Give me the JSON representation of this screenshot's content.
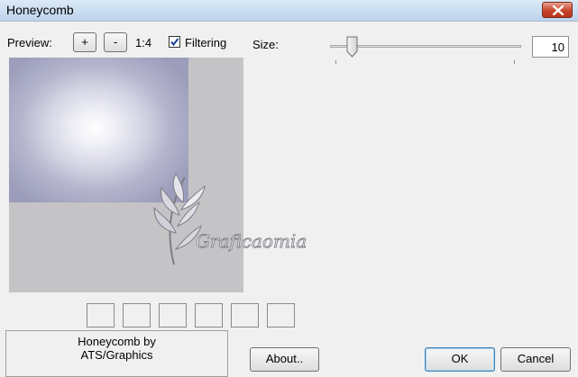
{
  "window": {
    "title": "Honeycomb"
  },
  "toolbar": {
    "preview_label": "Preview:",
    "zoom_in_label": "+",
    "zoom_out_label": "-",
    "zoom_level": "1:4",
    "filtering_label": "Filtering",
    "filtering_checked": true
  },
  "size": {
    "label": "Size:",
    "value": "10"
  },
  "watermark": {
    "text": "Graficaomia"
  },
  "info": {
    "line1": "Honeycomb by",
    "line2": "ATS/Graphics"
  },
  "buttons": {
    "about": "About..",
    "ok": "OK",
    "cancel": "Cancel"
  },
  "icons": {
    "close": "close-icon",
    "check": "checkmark-icon",
    "thumb": "slider-thumb-icon"
  }
}
